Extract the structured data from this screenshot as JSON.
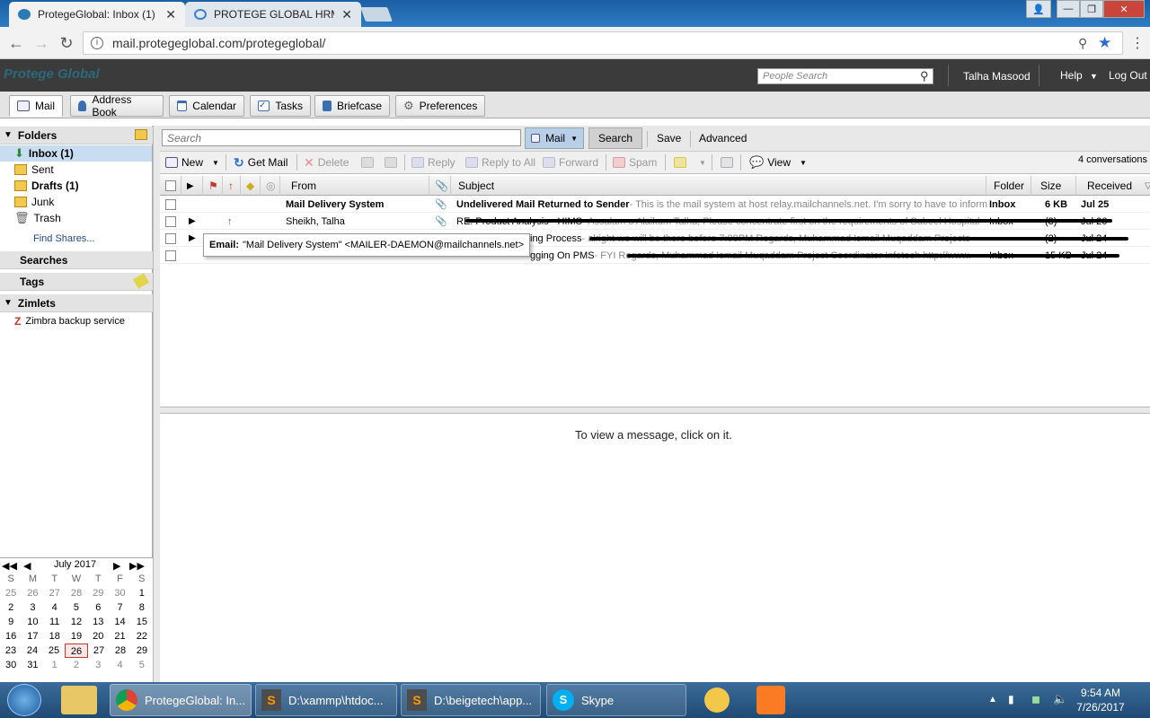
{
  "browser": {
    "tabs": [
      {
        "title": "ProtegeGlobal: Inbox (1)",
        "active": true
      },
      {
        "title": "PROTEGE GLOBAL HRM",
        "active": false
      }
    ],
    "url": "mail.protegeglobal.com/protegeglobal/"
  },
  "header": {
    "logo": "Protege Global",
    "people_search_placeholder": "People Search",
    "user": "Talha Masood",
    "help": "Help",
    "logout": "Log Out"
  },
  "apptabs": [
    {
      "label": "Mail",
      "icon": "mail-icon"
    },
    {
      "label": "Address Book",
      "icon": "contacts-icon"
    },
    {
      "label": "Calendar",
      "icon": "calendar-icon"
    },
    {
      "label": "Tasks",
      "icon": "tasks-icon"
    },
    {
      "label": "Briefcase",
      "icon": "briefcase-icon"
    },
    {
      "label": "Preferences",
      "icon": "gear-icon"
    }
  ],
  "sidebar": {
    "folders_label": "Folders",
    "folders": [
      {
        "label": "Inbox (1)",
        "bold": true,
        "selected": true
      },
      {
        "label": "Sent"
      },
      {
        "label": "Drafts (1)",
        "bold": true
      },
      {
        "label": "Junk"
      },
      {
        "label": "Trash"
      }
    ],
    "find_shares": "Find Shares...",
    "searches_label": "Searches",
    "tags_label": "Tags",
    "zimlets_label": "Zimlets",
    "zimlets": [
      {
        "label": "Zimbra backup service"
      }
    ]
  },
  "calendar": {
    "month": "July 2017",
    "weekdays": [
      "S",
      "M",
      "T",
      "W",
      "T",
      "F",
      "S"
    ],
    "weeks": [
      [
        "25",
        "26",
        "27",
        "28",
        "29",
        "30",
        "1"
      ],
      [
        "2",
        "3",
        "4",
        "5",
        "6",
        "7",
        "8"
      ],
      [
        "9",
        "10",
        "11",
        "12",
        "13",
        "14",
        "15"
      ],
      [
        "16",
        "17",
        "18",
        "19",
        "20",
        "21",
        "22"
      ],
      [
        "23",
        "24",
        "25",
        "26",
        "27",
        "28",
        "29"
      ],
      [
        "30",
        "31",
        "1",
        "2",
        "3",
        "4",
        "5"
      ]
    ],
    "today": "26"
  },
  "search": {
    "placeholder": "Search",
    "scope": "Mail",
    "search_btn": "Search",
    "save_btn": "Save",
    "advanced_btn": "Advanced"
  },
  "toolbar": {
    "new": "New",
    "getmail": "Get Mail",
    "delete": "Delete",
    "reply": "Reply",
    "replyall": "Reply to All",
    "forward": "Forward",
    "spam": "Spam",
    "view": "View",
    "count": "4 conversations"
  },
  "columns": {
    "from": "From",
    "subject": "Subject",
    "folder": "Folder",
    "size": "Size",
    "received": "Received"
  },
  "messages": [
    {
      "from": "Mail Delivery System",
      "subject": "Undelivered Mail Returned to Sender",
      "fragment": " - This is the mail system at host relay.mailchannels.net. I'm sorry to have to inform",
      "folder": "Inbox",
      "size": "6 KB",
      "received": "Jul 25",
      "unread": true
    },
    {
      "from": "Sheikh, Talha",
      "subject": "RE: Product Analysis - HIMS",
      "fragment": " - Assalam o Alaikum Talha, Please concentrate first on the requirements of Sabeel Hospital",
      "folder": "Inbox",
      "size": "(3)",
      "received": "Jul 26",
      "unread": false
    },
    {
      "from": "",
      "subject": "ing Process",
      "fragment": " - alright we will be there before 7:00PM Regards, Muhammad Ismail Muqaddam Projects",
      "folder": "",
      "size": "(2)",
      "received": "Jul 24",
      "unread": false
    },
    {
      "from": "",
      "subject": "gging On PMS",
      "fragment": " - FYI Regards, Muhammad Ismail Muqaddam Project Coordinator Infotech http://www.",
      "folder": "Inbox",
      "size": "15 KB",
      "received": "Jul 24",
      "unread": false
    }
  ],
  "tooltip": {
    "label": "Email:",
    "value": "\"Mail Delivery System\" <MAILER-DAEMON@mailchannels.net>"
  },
  "reading_pane": {
    "message": "To view a message, click on it."
  },
  "taskbar": {
    "items": [
      {
        "label": "ProtegeGlobal: In..."
      },
      {
        "label": "D:\\xammp\\htdoc..."
      },
      {
        "label": "D:\\beigetech\\app..."
      },
      {
        "label": "Skype"
      }
    ],
    "time": "9:54 AM",
    "date": "7/26/2017"
  }
}
